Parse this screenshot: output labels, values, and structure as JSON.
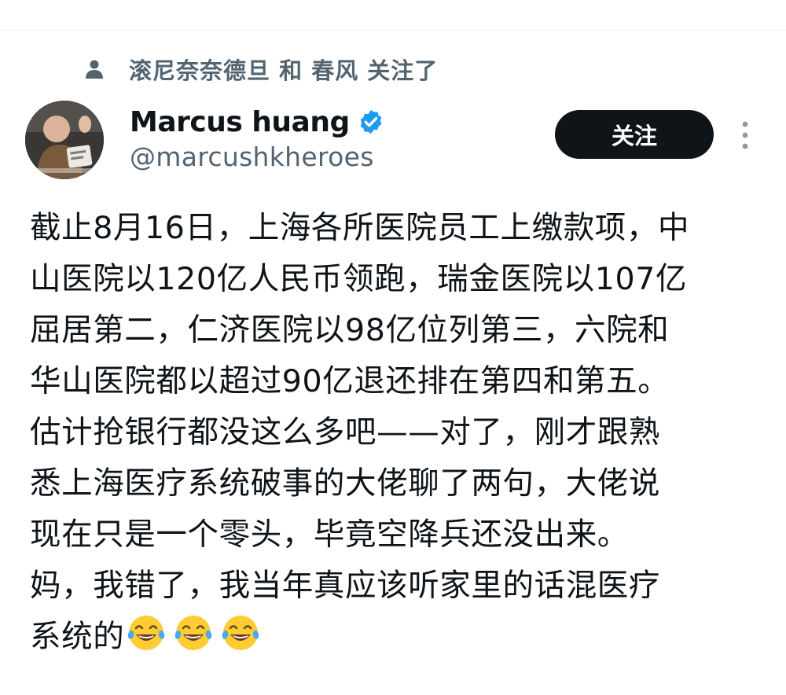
{
  "social_context": {
    "text": "滚尼奈奈德旦 和 春风 关注了",
    "icon": "person-icon"
  },
  "author": {
    "display_name": "Marcus huang",
    "handle": "@marcushkheroes",
    "verified": true,
    "verified_icon": "verified-badge-icon",
    "avatar_icon": "avatar"
  },
  "follow_button": {
    "label": "关注"
  },
  "more_menu": {
    "icon": "more-vertical-icon"
  },
  "tweet": {
    "lines": [
      "截止8月16日，上海各所医院员工上缴款项，中",
      "山医院以120亿人民币领跑，瑞金医院以107亿",
      "屈居第二，仁济医院以98亿位列第三，六院和",
      "华山医院都以超过90亿退还排在第四和第五。",
      "估计抢银行都没这么多吧——对了，刚才跟熟",
      "悉上海医疗系统破事的大佬聊了两句，大佬说",
      "现在只是一个零头，毕竟空降兵还没出来。",
      "妈，我错了，我当年真应该听家里的话混医疗",
      "系统的"
    ],
    "trailing_emoji": [
      "face-with-tears-of-joy-icon",
      "face-with-tears-of-joy-icon",
      "face-with-tears-of-joy-icon"
    ]
  },
  "colors": {
    "text_primary": "#0f1419",
    "text_secondary": "#536471",
    "follow_button_bg": "#0f1419",
    "verified_blue": "#1d9bf0",
    "emoji_yellow": "#ffcc33"
  }
}
